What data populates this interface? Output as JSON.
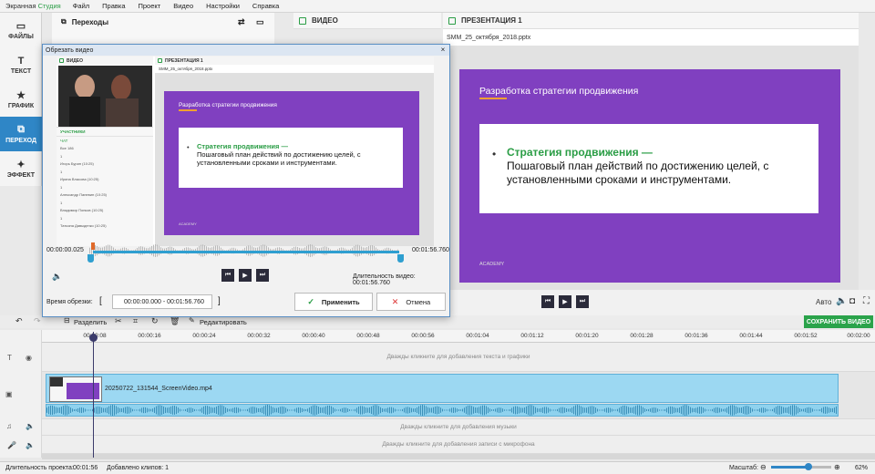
{
  "menubar": {
    "app_name": "Экранная",
    "app_name_accent": "Студия",
    "items": [
      "Файл",
      "Правка",
      "Проект",
      "Видео",
      "Настройки",
      "Справка"
    ]
  },
  "left_panel": {
    "items": [
      {
        "label": "ФАЙЛЫ",
        "icon": "folder-icon"
      },
      {
        "label": "ТЕКСТ",
        "icon": "text-icon"
      },
      {
        "label": "ГРАФИК",
        "icon": "star-icon"
      },
      {
        "label": "ПЕРЕХОД",
        "icon": "transition-icon",
        "active": true
      },
      {
        "label": "ЭФФЕКТ",
        "icon": "effects-icon"
      }
    ]
  },
  "transitions_panel": {
    "title": "Переходы"
  },
  "preview": {
    "video_tab": "ВИДЕО",
    "presentation_tab": "ПРЕЗЕНТАЦИЯ 1",
    "file_name": "SMM_25_октября_2018.pptx",
    "slide": {
      "title": "Разработка стратегии продвижения",
      "bullet_title": "Стратегия продвижения —",
      "bullet_text": "Пошаговый план действий по достижению целей, с установленными сроками и инструментами.",
      "logo": "ACADEMY"
    },
    "quality_label": "Авто"
  },
  "save_button": "СОХРАНИТЬ ВИДЕО",
  "toolbar": {
    "split_label": "Разделить",
    "edit_label": "Редактировать"
  },
  "timeline": {
    "ticks": [
      "00:00:08",
      "00:00:16",
      "00:00:24",
      "00:00:32",
      "00:00:40",
      "00:00:48",
      "00:00:56",
      "00:01:04",
      "00:01:12",
      "00:01:20",
      "00:01:28",
      "00:01:36",
      "00:01:44",
      "00:01:52",
      "00:02:00"
    ],
    "text_track_hint": "Дважды кликните для добавления текста и графики",
    "clip_name": "20250722_131544_ScreenVideo.mp4",
    "music_track_hint": "Дважды кликните для добавления музыки",
    "mic_track_hint": "Дважды кликните для добавления записи с микрофона"
  },
  "status": {
    "project_length_label": "Длительность проекта:",
    "project_length": "00:01:56",
    "clips_added": "Добавлено клипов: 1",
    "zoom_label": "Масштаб:",
    "zoom_value": "62%",
    "zoom_fraction": 0.62
  },
  "dialog": {
    "title": "Обрезать видео",
    "start_time": "00:00:00.025",
    "end_time": "00:01:56.760",
    "duration_label": "Длительность видео: 00:01:56.760",
    "cut_label": "Время обрезки:",
    "cut_range": "00:00:00.000 - 00:01:56.760",
    "apply_label": "Применить",
    "cancel_label": "Отмена",
    "inner": {
      "video_tab": "ВИДЕО",
      "presentation_tab": "ПРЕЗЕНТАЦИЯ 1",
      "file_name": "SMM_25_октября_2018.pptx",
      "participants_label": "УЧАСТНИКИ",
      "chat_label": "ЧАТ",
      "chat_lines": [
        "Все 186",
        "1",
        "Игорь Бурин (10:25)",
        "1",
        "Ирина Власова (10:25)",
        "1",
        "Александр Паневин (10:25)",
        "1",
        "Владимир Попков (10:25)",
        "1",
        "Татьяна Давыденко (10:25)"
      ]
    }
  }
}
